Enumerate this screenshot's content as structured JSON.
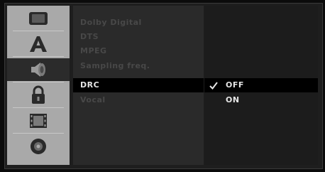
{
  "menu": {
    "items": [
      {
        "label": "Dolby Digital"
      },
      {
        "label": "DTS"
      },
      {
        "label": "MPEG"
      },
      {
        "label": "Sampling freq."
      },
      {
        "label": "DRC"
      },
      {
        "label": "Vocal"
      }
    ]
  },
  "options": {
    "items": [
      {
        "label": "OFF",
        "checked": true
      },
      {
        "label": "ON",
        "checked": false
      }
    ]
  },
  "icons": [
    "display-icon",
    "language-icon",
    "audio-speaker-icon",
    "lock-icon",
    "film-icon",
    "disc-icon"
  ],
  "colors": {
    "active_text": "#e6e6e6",
    "inactive_text": "#484848",
    "highlight": "#000000",
    "icon_panel": "#a9a9a9"
  }
}
